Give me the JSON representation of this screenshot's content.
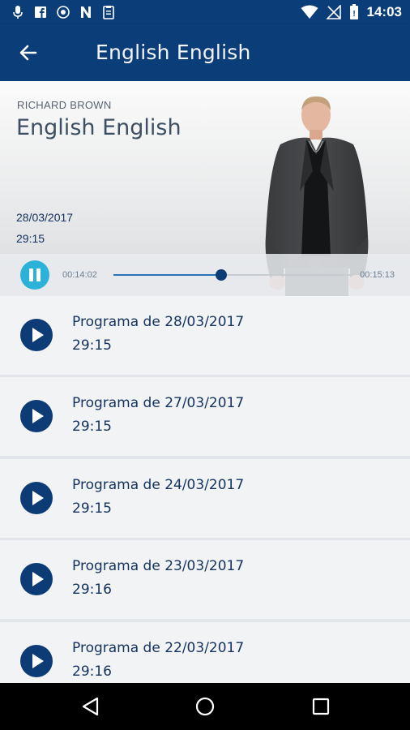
{
  "status_bar": {
    "time": "14:03",
    "icons_left": [
      "mic-icon",
      "facebook-icon",
      "vpn-icon",
      "n-icon",
      "clipboard-icon"
    ],
    "icons_right": [
      "wifi-icon",
      "no-signal-icon",
      "battery-icon"
    ]
  },
  "app_bar": {
    "back_icon": "arrow-left-icon",
    "title": "English English"
  },
  "header": {
    "author": "RICHARD BROWN",
    "title": "English English",
    "date": "28/03/2017",
    "duration": "29:15"
  },
  "player": {
    "state_icon": "pause-icon",
    "current_time": "00:14:02",
    "total_time": "00:15:13",
    "progress": 0.45
  },
  "episodes": [
    {
      "title": "Programa de 28/03/2017",
      "duration": "29:15"
    },
    {
      "title": "Programa de 27/03/2017",
      "duration": "29:15"
    },
    {
      "title": "Programa de 24/03/2017",
      "duration": "29:15"
    },
    {
      "title": "Programa de 23/03/2017",
      "duration": "29:16"
    },
    {
      "title": "Programa de 22/03/2017",
      "duration": "29:16"
    }
  ],
  "nav_bar": {
    "buttons": [
      "back-triangle-icon",
      "home-circle-icon",
      "recents-square-icon"
    ]
  },
  "colors": {
    "primary": "#0b3d79",
    "accent": "#2cb1d9",
    "text_dark": "#13325d"
  }
}
